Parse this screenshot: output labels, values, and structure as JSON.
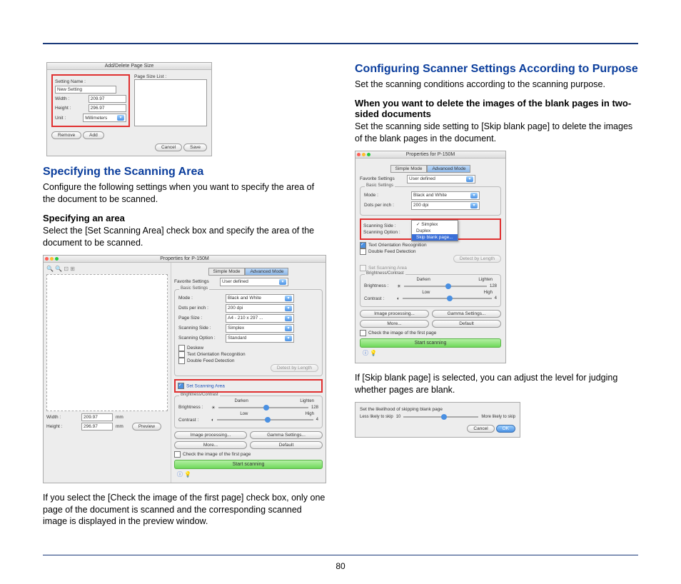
{
  "page_number": "80",
  "left": {
    "dialog1": {
      "title": "Add/Delete Page Size",
      "setting_name_label": "Setting Name :",
      "setting_name_value": "New Setting",
      "width_label": "Width :",
      "width_value": "209.97",
      "height_label": "Height :",
      "height_value": "296.97",
      "unit_label": "Unit :",
      "unit_value": "Millimeters",
      "page_size_list_label": "Page Size List :",
      "remove_btn": "Remove",
      "add_btn": "Add",
      "cancel_btn": "Cancel",
      "save_btn": "Save"
    },
    "h1": "Specifying the Scanning Area",
    "p1": "Configure the following settings when you want to specify the area of the document to be scanned.",
    "h2": "Specifying an area",
    "p2": "Select the [Set Scanning Area] check box and specify the area of the document to be scanned.",
    "dialog2": {
      "title": "Properties for P-150M",
      "tab_simple": "Simple Mode",
      "tab_advanced": "Advanced Mode",
      "fav_label": "Favorite Settings",
      "fav_value": "User defined",
      "basic_title": "Basic Settings",
      "mode_label": "Mode :",
      "mode_value": "Black and White",
      "dpi_label": "Dots per inch :",
      "dpi_value": "200 dpi",
      "psize_label": "Page Size :",
      "psize_value": "A4 - 210 x 297 ...",
      "side_label": "Scanning Side :",
      "side_value": "Simplex",
      "opt_label": "Scanning Option :",
      "opt_value": "Standard",
      "cb_deskew": "Deskew",
      "cb_orient": "Text Orientation Recognition",
      "cb_double": "Double Feed Detection",
      "detect_btn": "Detect by Length",
      "set_area": "Set Scanning Area",
      "bc_title": "Brightness/Contrast",
      "brightness_label": "Brightness :",
      "darken": "Darken",
      "lighten": "Lighten",
      "bval": "128",
      "contrast_label": "Contrast :",
      "low": "Low",
      "high": "High",
      "cval": "4",
      "img_proc": "Image processing...",
      "gamma": "Gamma Settings...",
      "more": "More...",
      "default": "Default",
      "cb_first": "Check the image of the first page",
      "start": "Start scanning",
      "width_lbl": "Width :",
      "width_val": "209.97",
      "height_lbl": "Height :",
      "height_val": "296.97",
      "unit": "mm",
      "preview_btn": "Preview"
    },
    "p3": "If you select the [Check the image of the first page] check box, only one page of the document is scanned and the corresponding scanned image is displayed in the preview window."
  },
  "right": {
    "h1": "Configuring Scanner Settings According to Purpose",
    "p1": "Set the scanning conditions according to the scanning purpose.",
    "h2": "When you want to delete the images of the blank pages in two-sided documents",
    "p2": "Set the scanning side setting to [Skip blank page] to delete the images of the blank pages in the document.",
    "dialog1": {
      "title": "Properties for P-150M",
      "tab_simple": "Simple Mode",
      "tab_advanced": "Advanced Mode",
      "fav_label": "Favorite Settings",
      "fav_value": "User defined",
      "basic_title": "Basic Settings",
      "mode_label": "Mode :",
      "mode_value": "Black and White",
      "dpi_label": "Dots per inch :",
      "dpi_value": "200 dpi",
      "side_label": "Scanning Side :",
      "opt_label": "Scanning Option :",
      "menu_simplex": "Simplex",
      "menu_duplex": "Duplex",
      "menu_skip": "Skip blank page...",
      "cb_orient": "Text Orientation Recognition",
      "cb_double": "Double Feed Detection",
      "detect_btn": "Detect by Length",
      "set_area": "Set Scanning Area",
      "bc_title": "Brightness/Contrast",
      "brightness_label": "Brightness :",
      "darken": "Darken",
      "lighten": "Lighten",
      "bval": "128",
      "contrast_label": "Contrast :",
      "low": "Low",
      "high": "High",
      "cval": "4",
      "img_proc": "Image processing...",
      "gamma": "Gamma Settings...",
      "more": "More...",
      "default": "Default",
      "cb_first": "Check the image of the first page",
      "start": "Start scanning"
    },
    "p3": "If [Skip blank page] is selected, you can adjust the level for judging whether pages are blank.",
    "dialog2": {
      "title": "Set the likelihood of skipping blank page",
      "less": "Less likely to skip",
      "val": "10",
      "more": "More likely to skip",
      "cancel": "Cancel",
      "ok": "OK"
    }
  }
}
